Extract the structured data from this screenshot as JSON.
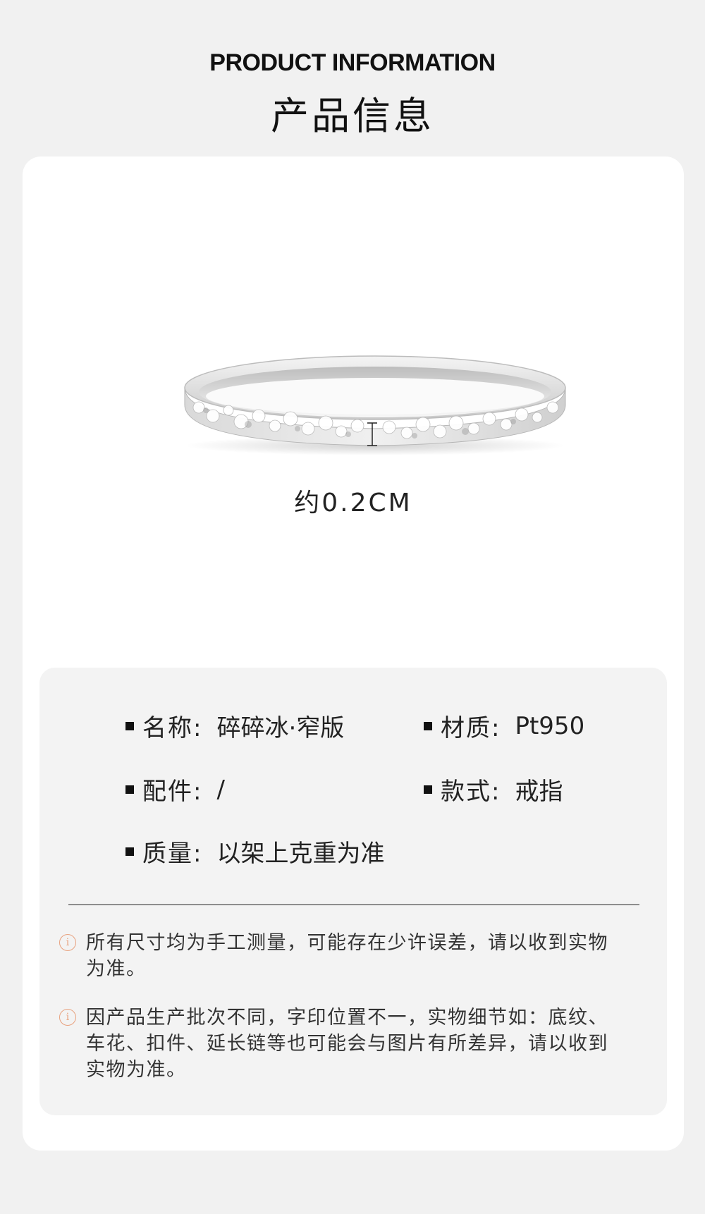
{
  "header": {
    "title_en": "PRODUCT INFORMATION",
    "title_zh": "产品信息"
  },
  "product_image": {
    "size_label": "约0.2CM"
  },
  "specs": {
    "name": {
      "key": "名称:",
      "value": "碎碎冰·窄版"
    },
    "material": {
      "key": "材质:",
      "value": "Pt950"
    },
    "accessory": {
      "key": "配件:",
      "value": "/"
    },
    "style": {
      "key": "款式:",
      "value": "戒指"
    },
    "weight": {
      "key": "质量:",
      "value": "以架上克重为准"
    }
  },
  "notes": [
    {
      "icon": "info-icon",
      "text": "所有尺寸均为手工测量，可能存在少许误差，请以收到实物为准。"
    },
    {
      "icon": "info-icon",
      "text": "因产品生产批次不同，字印位置不一，实物细节如：底纹、车花、扣件、延长链等也可能会与图片有所差异，请以收到实物为准。"
    }
  ],
  "colors": {
    "page_bg": "#f1f1f1",
    "card_bg": "#ffffff",
    "info_bg": "#f3f3f3",
    "note_icon": "#e8a27f"
  }
}
